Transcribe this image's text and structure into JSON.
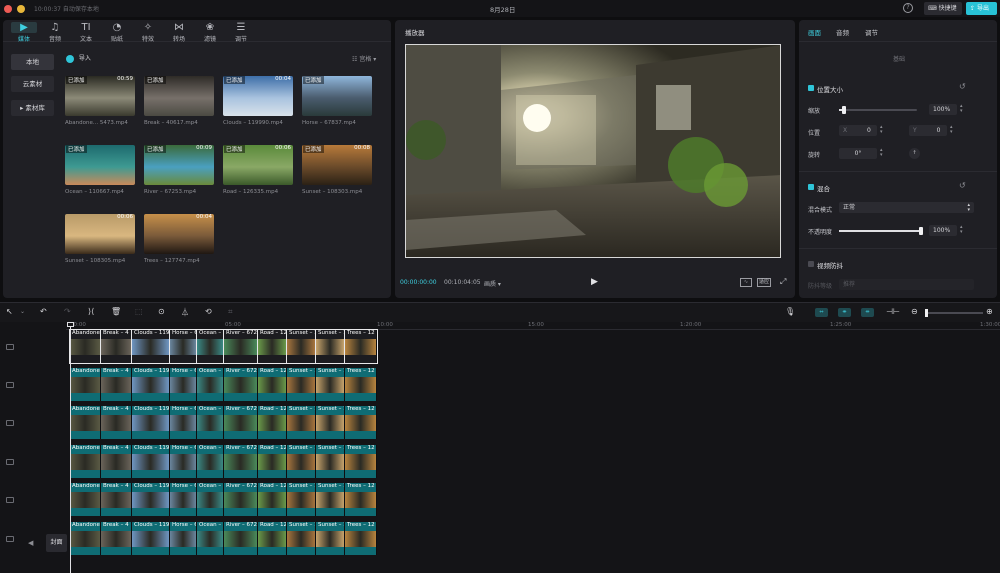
{
  "titlebar": {
    "save_status": "10:00:37 自动保存本地",
    "project_date": "8月28日",
    "shortcut_label": "快捷键",
    "export_label": "导出"
  },
  "toolbar": [
    {
      "icon": "media-icon",
      "glyph": "▶",
      "label": "媒体"
    },
    {
      "icon": "audio-icon",
      "glyph": "♫",
      "label": "音频"
    },
    {
      "icon": "text-icon",
      "glyph": "TI",
      "label": "文本"
    },
    {
      "icon": "sticker-icon",
      "glyph": "◔",
      "label": "贴纸"
    },
    {
      "icon": "effects-icon",
      "glyph": "✧",
      "label": "特效"
    },
    {
      "icon": "transition-icon",
      "glyph": "⋈",
      "label": "转场"
    },
    {
      "icon": "filter-icon",
      "glyph": "❀",
      "label": "滤镜"
    },
    {
      "icon": "adjust-icon",
      "glyph": "☰",
      "label": "调节"
    }
  ],
  "sidebar": {
    "items": [
      {
        "label": "本地"
      },
      {
        "label": "云素材"
      },
      {
        "label": "▸ 素材库"
      }
    ]
  },
  "media": {
    "import_label": "导入",
    "view_label": "宫格 ▾",
    "added_tag": "已添加",
    "items": [
      {
        "name": "Abandone... 5473.mp4",
        "duration": "00:59",
        "tag": "已添加",
        "colors": [
          "#2a2a22",
          "#8c8a78",
          "#3a3a2e"
        ]
      },
      {
        "name": "Break – 40617.mp4",
        "duration": "",
        "tag": "已添加",
        "colors": [
          "#2e2b27",
          "#77706a",
          "#4b4a42"
        ]
      },
      {
        "name": "Clouds – 119990.mp4",
        "duration": "00:04",
        "tag": "已添加",
        "colors": [
          "#3d6ea8",
          "#a9c3df",
          "#d9e2ea"
        ]
      },
      {
        "name": "Horse – 67837.mp4",
        "duration": "",
        "tag": "已添加",
        "colors": [
          "#8fb6dc",
          "#4a5c6e",
          "#2a3a3a"
        ]
      },
      {
        "name": "Ocean – 110667.mp4",
        "duration": "",
        "tag": "已添加",
        "colors": [
          "#1d6a6e",
          "#3e9a92",
          "#c98a5a"
        ]
      },
      {
        "name": "River – 67253.mp4",
        "duration": "00:09",
        "tag": "已添加",
        "colors": [
          "#3a6a3a",
          "#4aa0c0",
          "#6a8a3a"
        ]
      },
      {
        "name": "Road – 126335.mp4",
        "duration": "00:06",
        "tag": "已添加",
        "colors": [
          "#5a8a3a",
          "#8aa866",
          "#3b5a2a"
        ]
      },
      {
        "name": "Sunset – 108303.mp4",
        "duration": "00:08",
        "tag": "已添加",
        "colors": [
          "#b87a3a",
          "#6a4a2a",
          "#2b2115"
        ]
      },
      {
        "name": "Sunset – 108305.mp4",
        "duration": "00:06",
        "tag": "",
        "colors": [
          "#b89a68",
          "#d9b780",
          "#3a2a1a"
        ]
      },
      {
        "name": "Trees – 127747.mp4",
        "duration": "00:04",
        "tag": "",
        "colors": [
          "#c7904a",
          "#7a5a3a",
          "#1f1712"
        ]
      }
    ]
  },
  "player": {
    "title": "播放器",
    "current_time": "00:00:00:00",
    "total_time": "00:10:04:05",
    "quality": "画质 ▾",
    "ratio_label": "适应"
  },
  "inspector": {
    "tabs": [
      "画面",
      "音频",
      "调节"
    ],
    "section": "基础",
    "transform": {
      "title": "位置大小",
      "scale_label": "缩放",
      "scale_value": "100%",
      "scale_fraction": 0.06,
      "position_label": "位置",
      "x_label": "X",
      "x_value": "0",
      "y_label": "Y",
      "y_value": "0",
      "rotation_label": "旋转",
      "rotation_value": "0°"
    },
    "blend": {
      "title": "混合",
      "mode_label": "混合模式",
      "mode_value": "正常",
      "opacity_label": "不透明度",
      "opacity_value": "100%",
      "opacity_fraction": 1.0
    },
    "stabilize": {
      "title": "视频防抖",
      "level_label": "防抖等级",
      "level_value": "推荐"
    }
  },
  "timeline": {
    "ruler": [
      "00:00",
      "05:00",
      "10:00",
      "15:00",
      "1:20:00",
      "1:25:00",
      "1:30:00"
    ],
    "cover_label": "封面",
    "clips": [
      {
        "label": "Abandone",
        "color": "#5a5a44"
      },
      {
        "label": "Break – 4",
        "color": "#6a645a"
      },
      {
        "label": "Clouds – 119",
        "color": "#6f96c2"
      },
      {
        "label": "Horse – 6",
        "color": "#6a869e"
      },
      {
        "label": "Ocean – 1",
        "color": "#3a8a86"
      },
      {
        "label": "River – 672",
        "color": "#4a8a5a"
      },
      {
        "label": "Road – 12",
        "color": "#6a9a4a"
      },
      {
        "label": "Sunset – 1",
        "color": "#a9763e"
      },
      {
        "label": "Sunset – 1",
        "color": "#c8a46c"
      },
      {
        "label": "Trees – 12",
        "color": "#b8843e"
      }
    ]
  }
}
